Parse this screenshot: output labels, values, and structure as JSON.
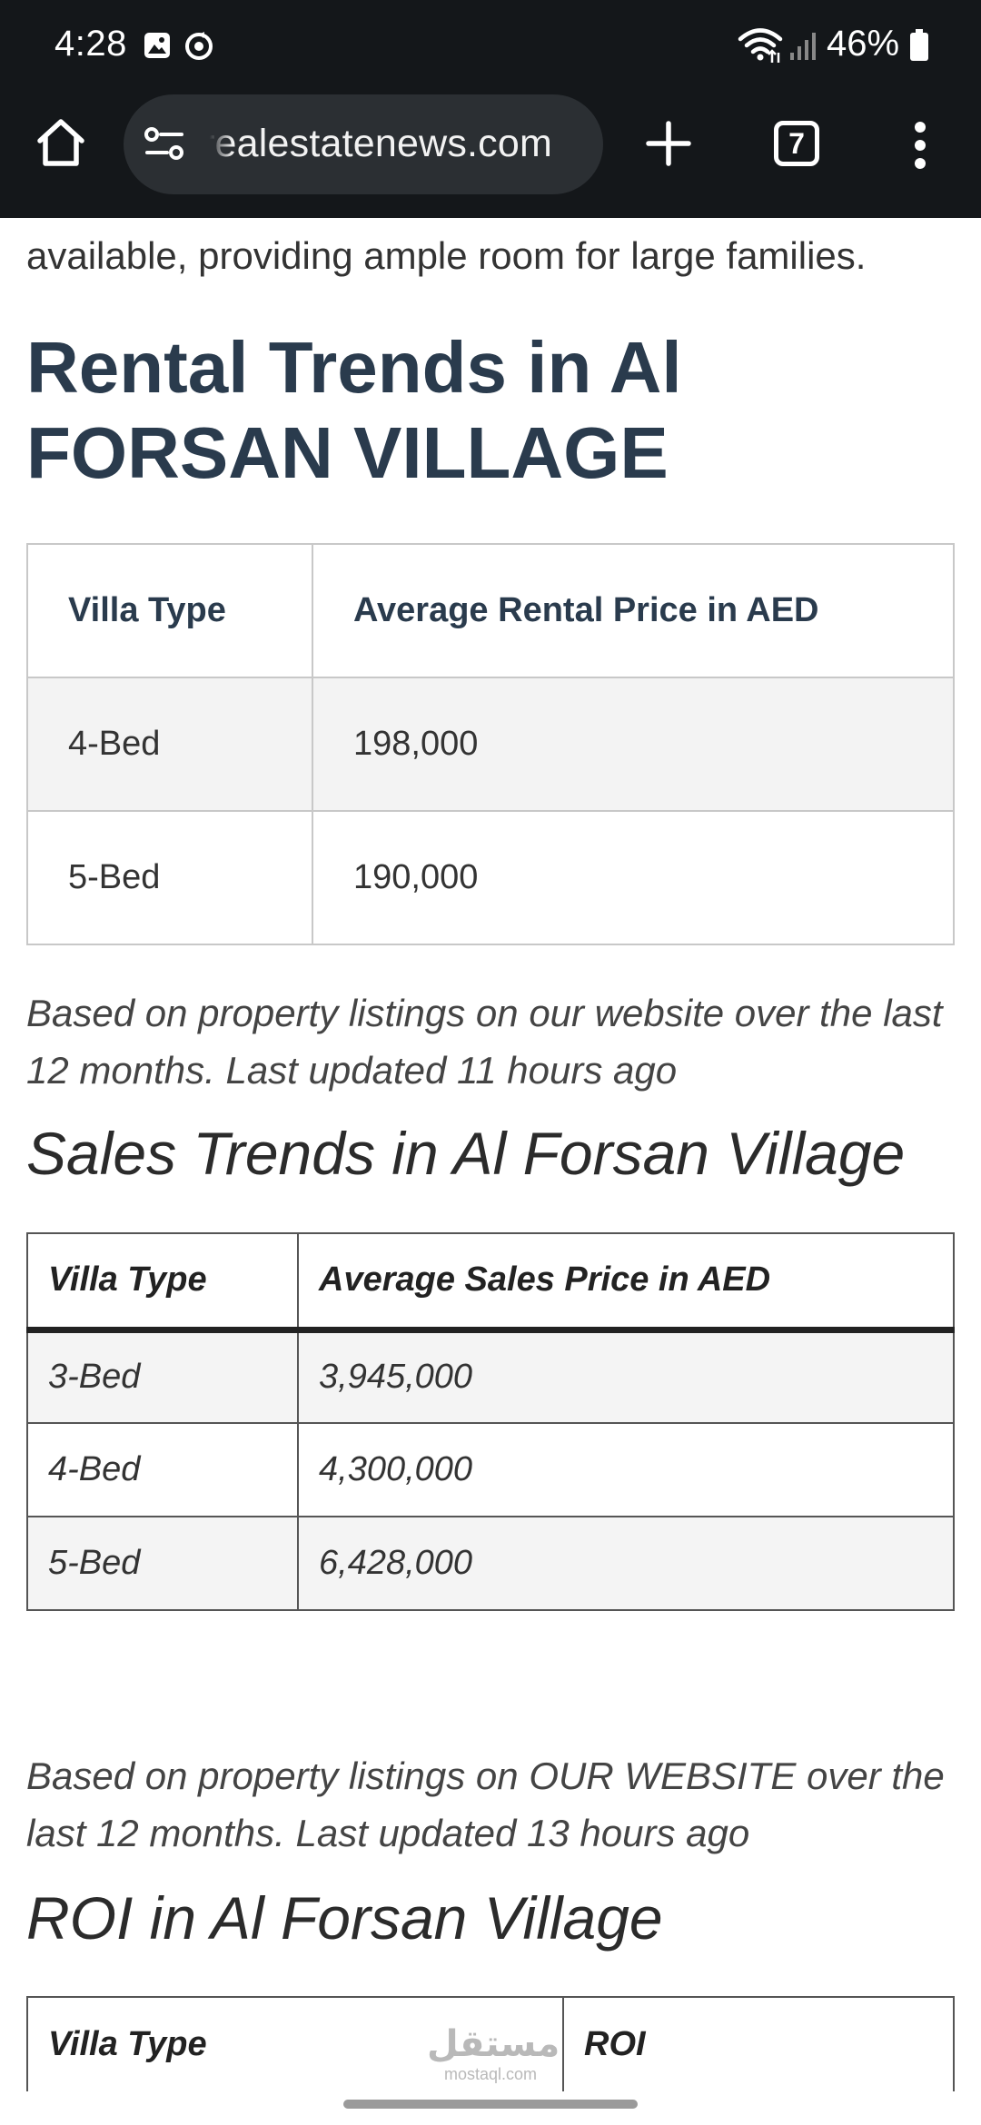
{
  "status_bar": {
    "time": "4:28",
    "battery": "46%",
    "icons": [
      "gallery-icon",
      "sync-icon",
      "wifi-icon",
      "signal-icon",
      "battery-icon"
    ]
  },
  "browser": {
    "url": "realestatenews.com",
    "tab_count": "7",
    "icons": [
      "home-icon",
      "site-settings-icon",
      "plus-icon",
      "tabs-icon",
      "more-vert-icon"
    ],
    "colors": {
      "toolbar": "#14171a",
      "urlbar": "#2b2f33"
    }
  },
  "article": {
    "intro_tail": "available, providing ample room for large families.",
    "rental_heading": "Rental Trends in Al FORSAN VILLAGE",
    "rental_table": {
      "headers": [
        "Villa Type",
        "Average Rental Price in AED"
      ],
      "rows": [
        [
          "4-Bed",
          "198,000"
        ],
        [
          "5-Bed",
          "190,000"
        ]
      ]
    },
    "rental_note": "Based on property listings on our website over the last 12 months. Last updated 11 hours ago",
    "sales_heading": "Sales Trends in Al Forsan Village",
    "sales_table": {
      "headers": [
        "Villa Type",
        "Average Sales Price in AED"
      ],
      "rows": [
        [
          "3-Bed",
          "3,945,000"
        ],
        [
          "4-Bed",
          "4,300,000"
        ],
        [
          "5-Bed",
          "6,428,000"
        ]
      ]
    },
    "sales_note": "Based on property listings on OUR WEBSITE over the last 12 months. Last updated 13 hours ago",
    "roi_heading": "ROI in Al Forsan Village",
    "roi_table": {
      "headers": [
        "Villa Type",
        "ROI"
      ]
    },
    "colors": {
      "heading": "#2a3b4d"
    }
  },
  "watermark": {
    "arabic": "مستقل",
    "latin": "mostaql.com"
  }
}
